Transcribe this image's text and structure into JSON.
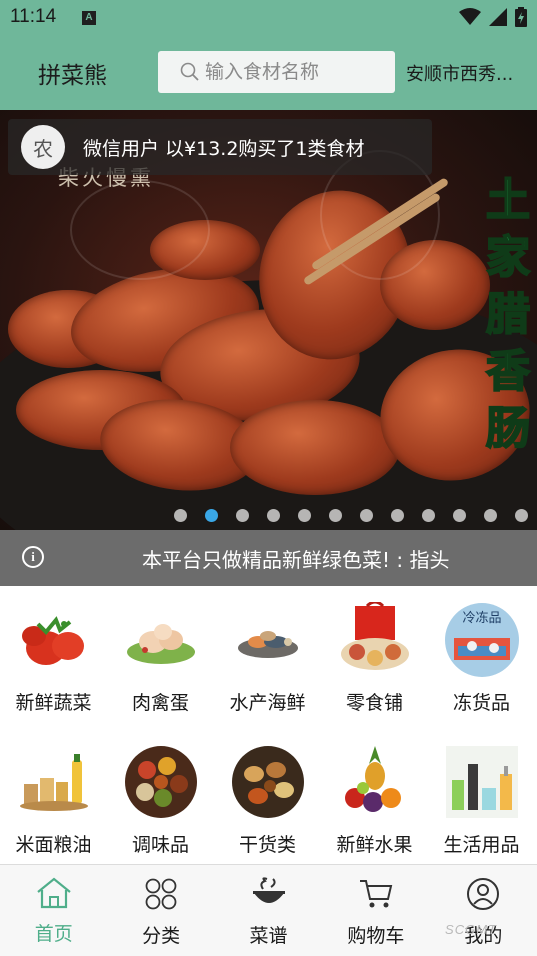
{
  "status_bar": {
    "time": "11:14",
    "app_badge": "A"
  },
  "header": {
    "brand": "拼菜熊",
    "search_placeholder": "输入食材名称",
    "location": "安顺市西秀..."
  },
  "banner": {
    "notice_avatar": "农",
    "notice_text": "微信用户 以¥13.2购买了1类食材",
    "slogan": "柴火慢熏",
    "side_text": [
      "土",
      "家",
      "腊",
      "香",
      "肠"
    ],
    "dot_count": 12,
    "active_dot": 1
  },
  "marquee": {
    "text": "本平台只做精品新鲜绿色菜! : 指头"
  },
  "categories": [
    {
      "label": "新鲜蔬菜",
      "icon": "vegetables-icon"
    },
    {
      "label": "肉禽蛋",
      "icon": "meat-poultry-icon"
    },
    {
      "label": "水产海鲜",
      "icon": "seafood-icon"
    },
    {
      "label": "零食铺",
      "icon": "snacks-icon"
    },
    {
      "label": "冻货品",
      "icon": "frozen-food-icon",
      "badge": "冷冻品"
    },
    {
      "label": "米面粮油",
      "icon": "grain-oil-icon"
    },
    {
      "label": "调味品",
      "icon": "seasoning-icon"
    },
    {
      "label": "干货类",
      "icon": "dried-goods-icon"
    },
    {
      "label": "新鲜水果",
      "icon": "fruit-icon"
    },
    {
      "label": "生活用品",
      "icon": "daily-goods-icon"
    }
  ],
  "tabs": [
    {
      "label": "首页",
      "icon": "home-icon",
      "active": true
    },
    {
      "label": "分类",
      "icon": "category-icon",
      "active": false
    },
    {
      "label": "菜谱",
      "icon": "recipe-icon",
      "active": false
    },
    {
      "label": "购物车",
      "icon": "cart-icon",
      "active": false
    },
    {
      "label": "我的",
      "icon": "user-icon",
      "active": false
    }
  ],
  "colors": {
    "header_green": "#6fb79a",
    "active_tab": "#4fae8a",
    "active_dot": "#3aa7e6",
    "marquee_bg": "#6c6c6c"
  },
  "watermark": "SCGMT"
}
